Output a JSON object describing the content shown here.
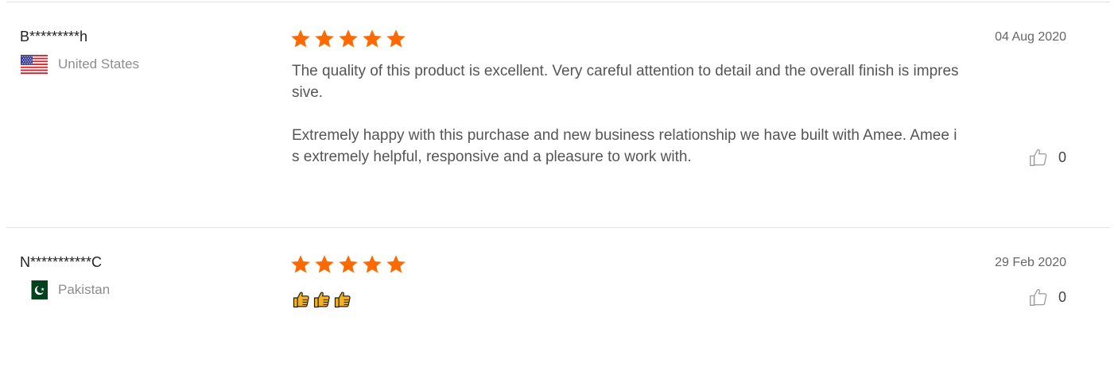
{
  "colors": {
    "star": "#ff6a00",
    "divider": "#e3e3e3",
    "text": "#555555",
    "muted": "#8d8d8d"
  },
  "reviews": [
    {
      "reviewer": "B*********h",
      "country": "United States",
      "flag_icon": "us-flag-icon",
      "rating": 5,
      "text_paragraphs": [
        "The quality of this product is excellent. Very careful attention to detail and the overall finish is impressive.",
        "Extremely happy with this purchase and new business relationship we have built with Amee. Amee is extremely helpful, responsive and a pleasure to work with."
      ],
      "date": "04 Aug 2020",
      "helpful_icon": "thumbs-up-outline-icon",
      "helpful_count": "0"
    },
    {
      "reviewer": "N***********C",
      "country": "Pakistan",
      "flag_icon": "pakistan-flag-icon",
      "rating": 5,
      "emoji_icons": [
        "thumbs-up-emoji",
        "thumbs-up-emoji",
        "thumbs-up-emoji"
      ],
      "date": "29 Feb 2020",
      "helpful_icon": "thumbs-up-outline-icon",
      "helpful_count": "0"
    }
  ]
}
